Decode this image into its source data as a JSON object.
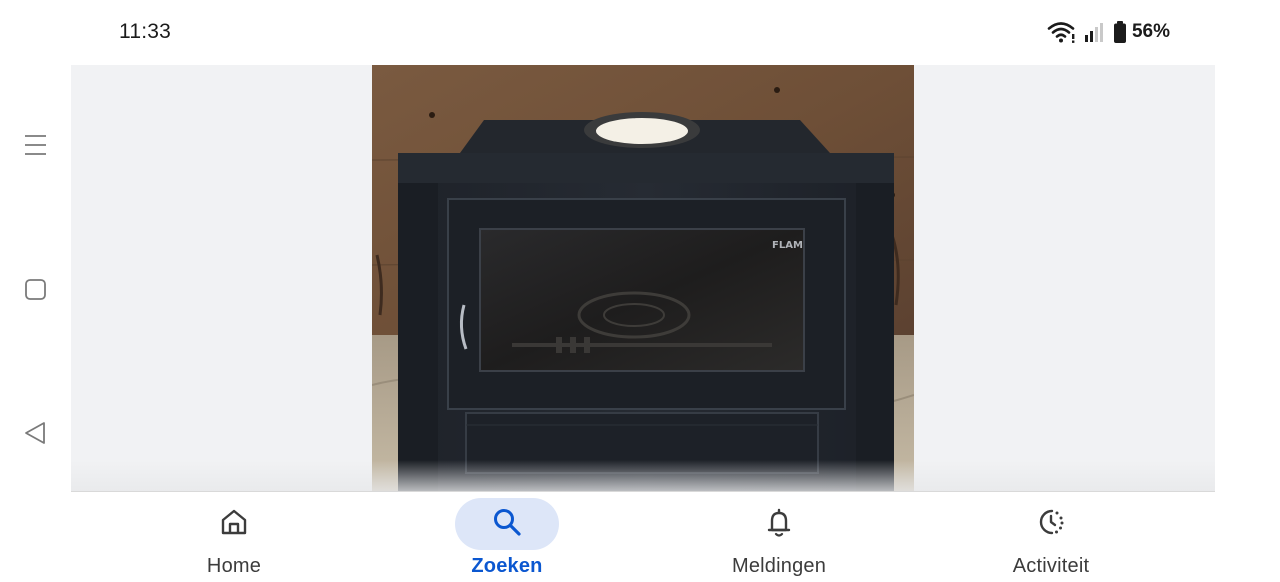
{
  "status_bar": {
    "time": "11:33",
    "battery_percent": "56%",
    "icons": [
      "wifi-icon",
      "signal-icon",
      "battery-icon"
    ]
  },
  "system_nav": {
    "buttons": [
      "menu-icon",
      "home-square-icon",
      "back-triangle-icon"
    ]
  },
  "photo": {
    "brand_text": "FLAM"
  },
  "bottom_nav": {
    "active_color": "#0b57d0",
    "active_bg": "#dde6f8",
    "items": [
      {
        "label": "Home",
        "icon": "home-icon",
        "active": false
      },
      {
        "label": "Zoeken",
        "icon": "search-icon",
        "active": true
      },
      {
        "label": "Meldingen",
        "icon": "bell-icon",
        "active": false
      },
      {
        "label": "Activiteit",
        "icon": "activity-icon",
        "active": false
      }
    ]
  }
}
